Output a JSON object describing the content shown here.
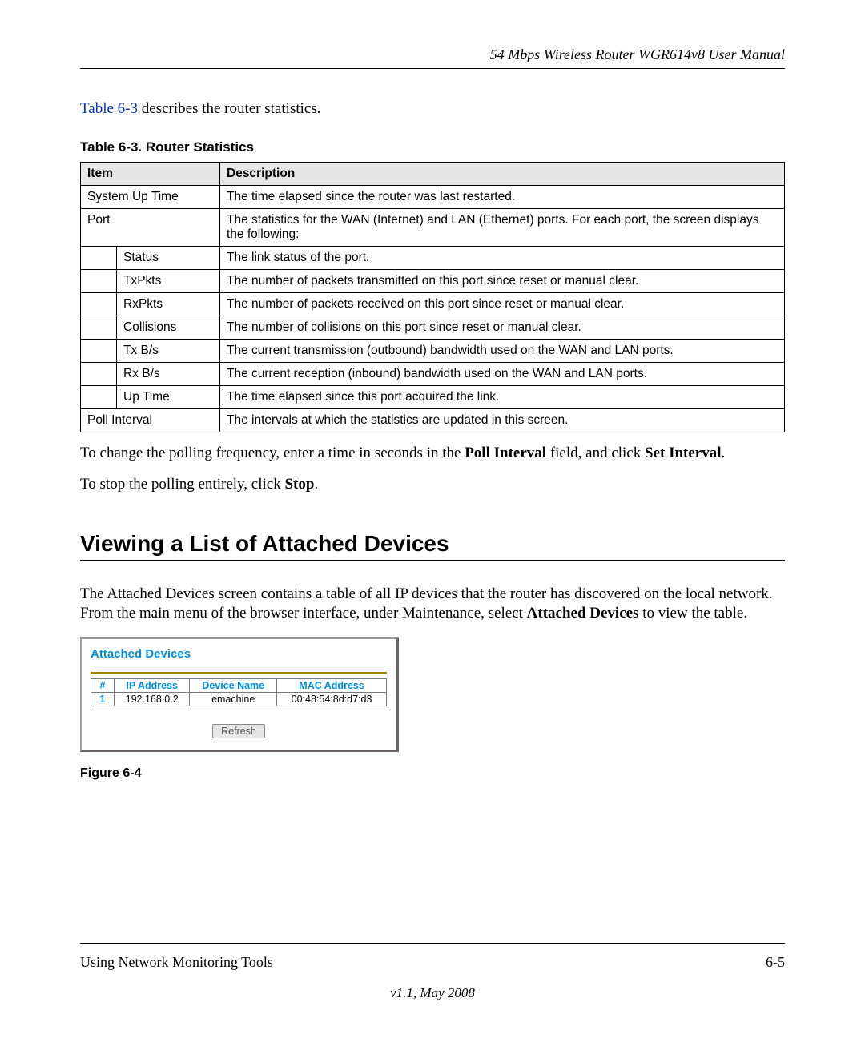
{
  "header": {
    "title": "54 Mbps Wireless Router WGR614v8 User Manual"
  },
  "intro": {
    "link_text": "Table 6-3",
    "rest": " describes the router statistics."
  },
  "table": {
    "caption": "Table 6-3. Router Statistics",
    "head_item": "Item",
    "head_desc": "Description",
    "rows": {
      "system_up_time": {
        "item": "System Up Time",
        "desc": "The time elapsed since the router was last restarted."
      },
      "port": {
        "item": "Port",
        "desc": "The statistics for the WAN (Internet) and LAN (Ethernet) ports. For each port, the screen displays the following:"
      },
      "status": {
        "item": "Status",
        "desc": "The link status of the port."
      },
      "txpkts": {
        "item": "TxPkts",
        "desc": "The number of packets transmitted on this port since reset or manual clear."
      },
      "rxpkts": {
        "item": "RxPkts",
        "desc": "The number of packets received on this port since reset or manual clear."
      },
      "collisions": {
        "item": "Collisions",
        "desc": "The number of collisions on this port since reset or manual clear."
      },
      "txbs": {
        "item": "Tx B/s",
        "desc": "The current transmission (outbound) bandwidth used on the WAN and LAN ports."
      },
      "rxbs": {
        "item": "Rx B/s",
        "desc": "The current reception (inbound) bandwidth used on the WAN and LAN ports."
      },
      "uptime": {
        "item": "Up Time",
        "desc": "The time elapsed since this port acquired the link."
      },
      "poll": {
        "item": "Poll Interval",
        "desc": "The intervals at which the statistics are updated in this screen."
      }
    }
  },
  "para1": {
    "part1": "To change the polling frequency, enter a time in seconds in the ",
    "bold1": "Poll Interval",
    "part2": " field, and click ",
    "bold2": "Set Interval",
    "part3": "."
  },
  "para2": {
    "part1": "To stop the polling entirely, click ",
    "bold1": "Stop",
    "part2": "."
  },
  "heading": "Viewing a List of Attached Devices",
  "para3": {
    "part1": "The Attached Devices screen contains a table of all IP devices that the router has discovered on the local network. From the main menu of the browser interface, under Maintenance, select ",
    "bold1": "Attached Devices",
    "part2": " to view the table."
  },
  "figure": {
    "title": "Attached Devices",
    "head_num": "#",
    "head_ip": "IP Address",
    "head_name": "Device Name",
    "head_mac": "MAC Address",
    "row1": {
      "num": "1",
      "ip": "192.168.0.2",
      "name": "emachine",
      "mac": "00:48:54:8d:d7:d3"
    },
    "refresh": "Refresh",
    "caption": "Figure 6-4"
  },
  "footer": {
    "left": "Using Network Monitoring Tools",
    "right": "6-5",
    "version": "v1.1, May 2008"
  }
}
